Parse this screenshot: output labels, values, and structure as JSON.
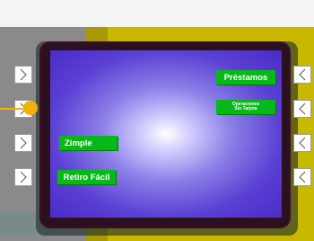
{
  "atm": {
    "left_buttons": [
      {
        "icon": "chevron-right-icon"
      },
      {
        "icon": "chevron-right-icon"
      },
      {
        "icon": "chevron-right-icon"
      },
      {
        "icon": "chevron-right-icon"
      }
    ],
    "right_buttons": [
      {
        "icon": "chevron-left-icon"
      },
      {
        "icon": "chevron-left-icon"
      },
      {
        "icon": "chevron-left-icon"
      },
      {
        "icon": "chevron-left-icon"
      }
    ],
    "menu": {
      "prestamos": "Préstamos",
      "operaciones_line1": "Operaciones",
      "operaciones_line2": "Sin Tarjeta",
      "zimple": "Zimple",
      "retiro_facil": "Retiro Fácil"
    }
  },
  "colors": {
    "button_green": "#08b818",
    "screen_blue": "#4a2bc8",
    "frame_yellow": "#c8b800",
    "pointer_orange": "#f3b00a"
  }
}
